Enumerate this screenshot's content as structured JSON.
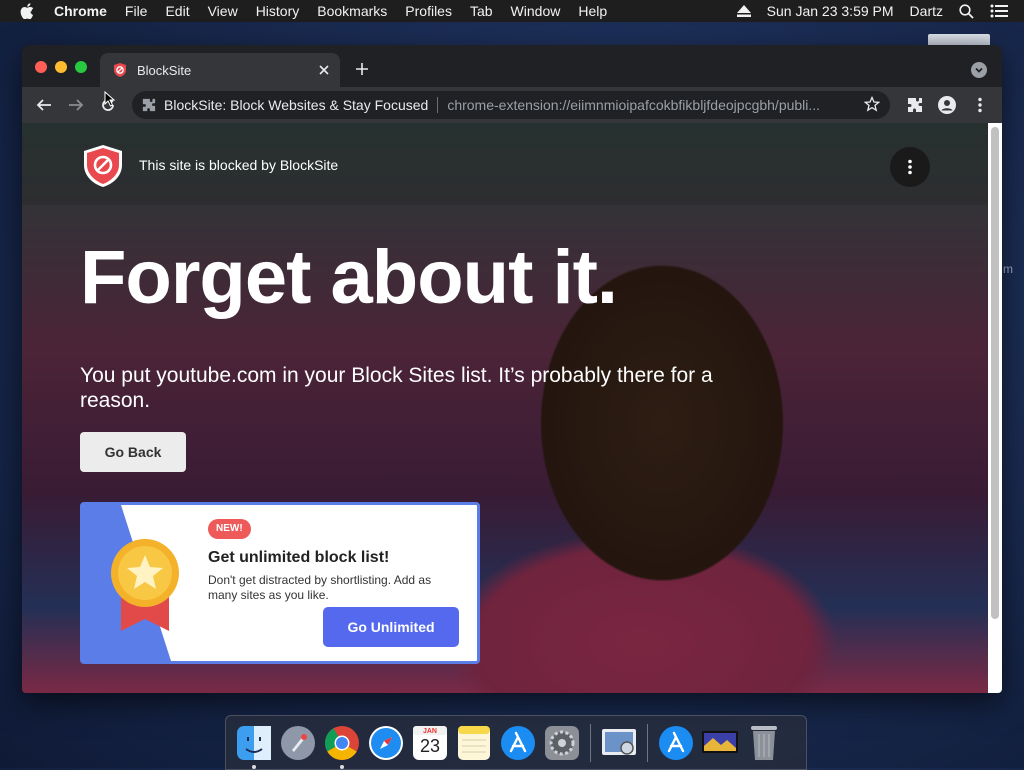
{
  "menubar": {
    "app_name": "Chrome",
    "items": [
      "File",
      "Edit",
      "View",
      "History",
      "Bookmarks",
      "Profiles",
      "Tab",
      "Window",
      "Help"
    ],
    "datetime": "Sun Jan 23  3:59 PM",
    "user": "Dartz"
  },
  "desktop": {
    "peek_text": "m"
  },
  "browser": {
    "tab_title": "BlockSite",
    "omnibox_title": "BlockSite: Block Websites & Stay Focused",
    "url": "chrome-extension://eiimnmioipafcokbfikbljfdeojpcgbh/publi..."
  },
  "page": {
    "blocked_notice": "This site is blocked by BlockSite",
    "headline": "Forget about it.",
    "subtext": "You put youtube.com in your Block Sites list. It’s probably there for a reason.",
    "go_back_label": "Go Back",
    "promo": {
      "badge": "NEW!",
      "title": "Get unlimited block list!",
      "description": "Don't get distracted by shortlisting. Add as many sites as you like.",
      "cta_label": "Go Unlimited"
    }
  },
  "dock": {
    "calendar_month": "JAN",
    "calendar_day": "23",
    "items": [
      "finder-icon",
      "launchpad-icon",
      "chrome-icon",
      "safari-icon",
      "calendar-icon",
      "notes-icon",
      "app-store-icon",
      "system-preferences-icon",
      "preview-icon",
      "app-store-icon",
      "tv-icon",
      "trash-icon"
    ]
  },
  "colors": {
    "accent_blue": "#5469ee",
    "badge_red": "#ee5a5a",
    "shield_red": "#e9484e"
  }
}
